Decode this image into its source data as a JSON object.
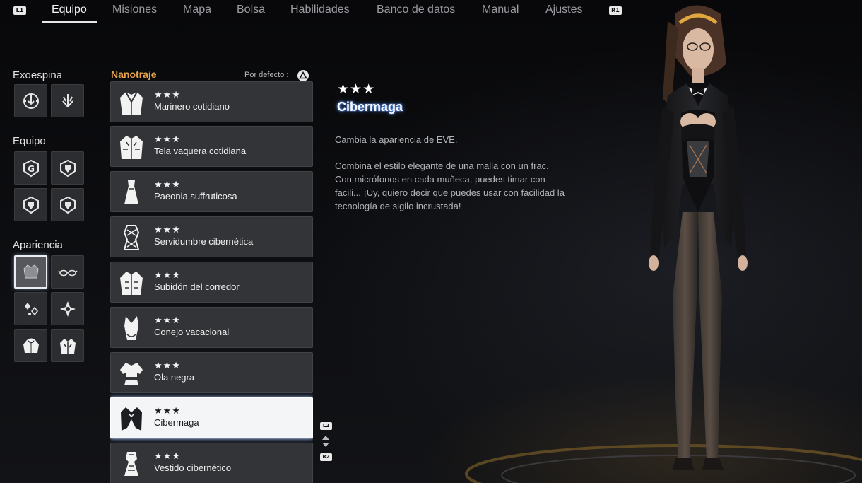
{
  "nav": {
    "left_hint": "L1",
    "right_hint": "R1",
    "tabs": [
      {
        "label": "Equipo",
        "active": true
      },
      {
        "label": "Misiones",
        "active": false
      },
      {
        "label": "Mapa",
        "active": false
      },
      {
        "label": "Bolsa",
        "active": false
      },
      {
        "label": "Habilidades",
        "active": false
      },
      {
        "label": "Banco de datos",
        "active": false
      },
      {
        "label": "Manual",
        "active": false
      },
      {
        "label": "Ajustes",
        "active": false
      }
    ]
  },
  "categories": {
    "exospine": {
      "title": "Exoespina",
      "slots": [
        "exospine-gear-icon",
        "exospine-claw-icon"
      ]
    },
    "gear": {
      "title": "Equipo",
      "slots": [
        "gear-g-icon",
        "gear-shield-icon",
        "gear-shield-icon",
        "gear-shield-icon"
      ]
    },
    "appearance": {
      "title": "Apariencia",
      "selected_index": 0,
      "slots": [
        "nanosuit-icon",
        "glasses-icon",
        "earrings-icon",
        "hair-ornament-icon",
        "hoodie-icon",
        "jacket-icon"
      ]
    }
  },
  "list": {
    "title": "Nanotraje",
    "sort_label": "Por defecto",
    "sort_button": "triangle-button-icon",
    "scroll_up_hint": "L2",
    "scroll_down_hint": "R2",
    "selected_index": 7,
    "items": [
      {
        "stars": "★★★",
        "name": "Marinero cotidiano",
        "icon": "sailor-outfit-icon"
      },
      {
        "stars": "★★★",
        "name": "Tela vaquera cotidiana",
        "icon": "denim-jacket-icon"
      },
      {
        "stars": "★★★",
        "name": "Paeonia suffruticosa",
        "icon": "dress-icon"
      },
      {
        "stars": "★★★",
        "name": "Servidumbre cibernética",
        "icon": "corset-icon"
      },
      {
        "stars": "★★★",
        "name": "Subidón del corredor",
        "icon": "runner-jacket-icon"
      },
      {
        "stars": "★★★",
        "name": "Conejo vacacional",
        "icon": "bodysuit-icon"
      },
      {
        "stars": "★★★",
        "name": "Ola negra",
        "icon": "crop-top-icon"
      },
      {
        "stars": "★★★",
        "name": "Cibermaga",
        "icon": "tailcoat-icon"
      },
      {
        "stars": "★★★",
        "name": "Vestido cibernético",
        "icon": "cyber-dress-icon"
      }
    ]
  },
  "detail": {
    "stars": "★★★",
    "name": "Cibermaga",
    "summary": "Cambia la apariencia de EVE.",
    "description": "Combina el estilo elegante de una malla con un frac. Con micrófonos en cada muñeca, puedes timar con facili... ¡Uy, quiero decir que puedes usar con facilidad la tecnología de sigilo incrustada!"
  },
  "colors": {
    "accent_orange": "#e7a14a",
    "selection_glow": "#5a96ff",
    "item_bg": "#333437"
  }
}
